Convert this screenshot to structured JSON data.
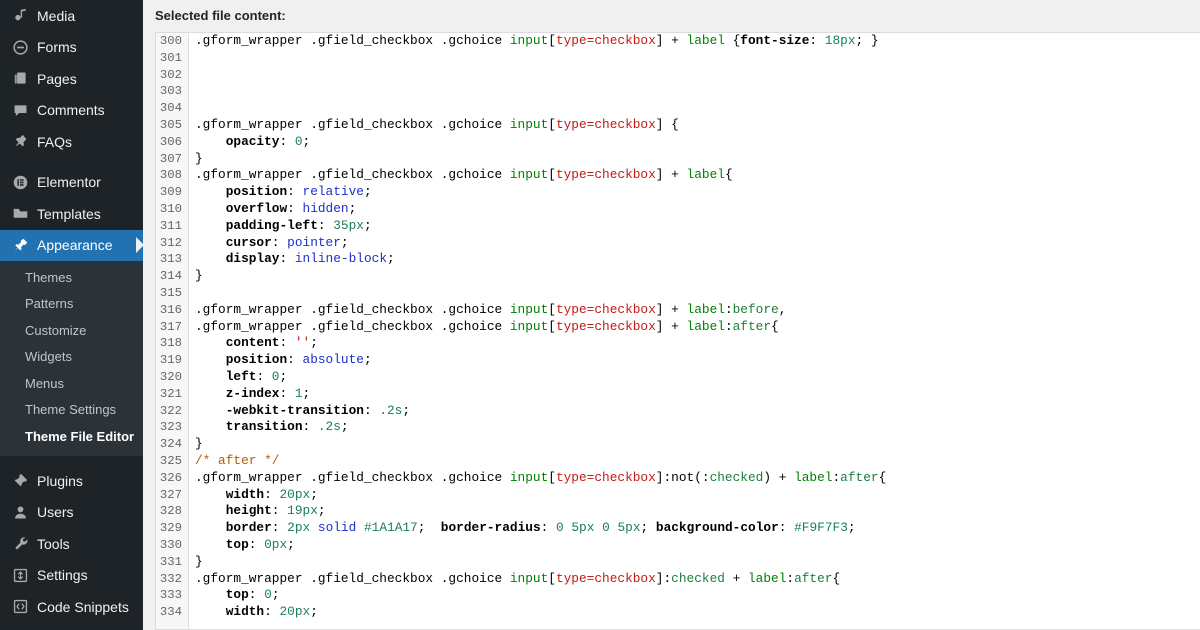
{
  "sidebar": {
    "items": [
      {
        "label": "Media",
        "icon": "media-icon",
        "current": false
      },
      {
        "label": "Forms",
        "icon": "forms-icon",
        "current": false
      },
      {
        "label": "Pages",
        "icon": "pages-icon",
        "current": false
      },
      {
        "label": "Comments",
        "icon": "comments-icon",
        "current": false
      },
      {
        "label": "FAQs",
        "icon": "pin-icon",
        "current": false
      },
      {
        "label": "Elementor",
        "icon": "elementor-icon",
        "current": false
      },
      {
        "label": "Templates",
        "icon": "templates-icon",
        "current": false
      },
      {
        "label": "Appearance",
        "icon": "appearance-icon",
        "current": true
      },
      {
        "label": "Plugins",
        "icon": "plugins-icon",
        "current": false
      },
      {
        "label": "Users",
        "icon": "users-icon",
        "current": false
      },
      {
        "label": "Tools",
        "icon": "tools-icon",
        "current": false
      },
      {
        "label": "Settings",
        "icon": "settings-icon",
        "current": false
      },
      {
        "label": "Code Snippets",
        "icon": "code-icon",
        "current": false
      }
    ],
    "submenu": [
      {
        "label": "Themes",
        "current": false
      },
      {
        "label": "Patterns",
        "current": false
      },
      {
        "label": "Customize",
        "current": false
      },
      {
        "label": "Widgets",
        "current": false
      },
      {
        "label": "Menus",
        "current": false
      },
      {
        "label": "Theme Settings",
        "current": false
      },
      {
        "label": "Theme File Editor",
        "current": true
      }
    ],
    "colors": {
      "background": "#1d2327",
      "submenu_background": "#2c3338",
      "current_highlight": "#2271b1",
      "text": "#f0f0f1",
      "icon": "#a7aaad"
    }
  },
  "main": {
    "content_label": "Selected file content:",
    "editor": {
      "first_line_number": 300,
      "lines": [
        {
          "n": 300,
          "tokens": [
            {
              "t": "sel",
              "v": ".gform_wrapper .gfield_checkbox .gchoice "
            },
            {
              "t": "tag",
              "v": "input"
            },
            {
              "t": "punct",
              "v": "["
            },
            {
              "t": "attr",
              "v": "type=checkbox"
            },
            {
              "t": "punct",
              "v": "]"
            },
            {
              "t": "sel",
              "v": " + "
            },
            {
              "t": "tag",
              "v": "label"
            },
            {
              "t": "sel",
              "v": " {"
            },
            {
              "t": "prop",
              "v": "font-size"
            },
            {
              "t": "punct",
              "v": ": "
            },
            {
              "t": "num",
              "v": "18px"
            },
            {
              "t": "punct",
              "v": "; }"
            }
          ]
        },
        {
          "n": 301,
          "tokens": []
        },
        {
          "n": 302,
          "tokens": []
        },
        {
          "n": 303,
          "tokens": []
        },
        {
          "n": 304,
          "tokens": []
        },
        {
          "n": 305,
          "tokens": [
            {
              "t": "sel",
              "v": ".gform_wrapper .gfield_checkbox .gchoice "
            },
            {
              "t": "tag",
              "v": "input"
            },
            {
              "t": "punct",
              "v": "["
            },
            {
              "t": "attr",
              "v": "type=checkbox"
            },
            {
              "t": "punct",
              "v": "]"
            },
            {
              "t": "sel",
              "v": " {"
            }
          ]
        },
        {
          "n": 306,
          "tokens": [
            {
              "t": "prop",
              "v": "    opacity"
            },
            {
              "t": "punct",
              "v": ": "
            },
            {
              "t": "num",
              "v": "0"
            },
            {
              "t": "punct",
              "v": ";"
            }
          ]
        },
        {
          "n": 307,
          "tokens": [
            {
              "t": "punct",
              "v": "}"
            }
          ]
        },
        {
          "n": 308,
          "tokens": [
            {
              "t": "sel",
              "v": ".gform_wrapper .gfield_checkbox .gchoice "
            },
            {
              "t": "tag",
              "v": "input"
            },
            {
              "t": "punct",
              "v": "["
            },
            {
              "t": "attr",
              "v": "type=checkbox"
            },
            {
              "t": "punct",
              "v": "]"
            },
            {
              "t": "sel",
              "v": " + "
            },
            {
              "t": "tag",
              "v": "label"
            },
            {
              "t": "sel",
              "v": "{"
            }
          ]
        },
        {
          "n": 309,
          "tokens": [
            {
              "t": "prop",
              "v": "    position"
            },
            {
              "t": "punct",
              "v": ": "
            },
            {
              "t": "kw",
              "v": "relative"
            },
            {
              "t": "punct",
              "v": ";"
            }
          ]
        },
        {
          "n": 310,
          "tokens": [
            {
              "t": "prop",
              "v": "    overflow"
            },
            {
              "t": "punct",
              "v": ": "
            },
            {
              "t": "kw",
              "v": "hidden"
            },
            {
              "t": "punct",
              "v": ";"
            }
          ]
        },
        {
          "n": 311,
          "tokens": [
            {
              "t": "prop",
              "v": "    padding-left"
            },
            {
              "t": "punct",
              "v": ": "
            },
            {
              "t": "num",
              "v": "35px"
            },
            {
              "t": "punct",
              "v": ";"
            }
          ]
        },
        {
          "n": 312,
          "tokens": [
            {
              "t": "prop",
              "v": "    cursor"
            },
            {
              "t": "punct",
              "v": ": "
            },
            {
              "t": "kw",
              "v": "pointer"
            },
            {
              "t": "punct",
              "v": ";"
            }
          ]
        },
        {
          "n": 313,
          "tokens": [
            {
              "t": "prop",
              "v": "    display"
            },
            {
              "t": "punct",
              "v": ": "
            },
            {
              "t": "kw",
              "v": "inline-block"
            },
            {
              "t": "punct",
              "v": ";"
            }
          ]
        },
        {
          "n": 314,
          "tokens": [
            {
              "t": "punct",
              "v": "}"
            }
          ]
        },
        {
          "n": 315,
          "tokens": []
        },
        {
          "n": 316,
          "tokens": [
            {
              "t": "sel",
              "v": ".gform_wrapper .gfield_checkbox .gchoice "
            },
            {
              "t": "tag",
              "v": "input"
            },
            {
              "t": "punct",
              "v": "["
            },
            {
              "t": "attr",
              "v": "type=checkbox"
            },
            {
              "t": "punct",
              "v": "]"
            },
            {
              "t": "sel",
              "v": " + "
            },
            {
              "t": "tag",
              "v": "label"
            },
            {
              "t": "punct",
              "v": ":"
            },
            {
              "t": "pseudo",
              "v": "before"
            },
            {
              "t": "punct",
              "v": ","
            }
          ]
        },
        {
          "n": 317,
          "tokens": [
            {
              "t": "sel",
              "v": ".gform_wrapper .gfield_checkbox .gchoice "
            },
            {
              "t": "tag",
              "v": "input"
            },
            {
              "t": "punct",
              "v": "["
            },
            {
              "t": "attr",
              "v": "type=checkbox"
            },
            {
              "t": "punct",
              "v": "]"
            },
            {
              "t": "sel",
              "v": " + "
            },
            {
              "t": "tag",
              "v": "label"
            },
            {
              "t": "punct",
              "v": ":"
            },
            {
              "t": "pseudo",
              "v": "after"
            },
            {
              "t": "punct",
              "v": "{"
            }
          ]
        },
        {
          "n": 318,
          "tokens": [
            {
              "t": "prop",
              "v": "    content"
            },
            {
              "t": "punct",
              "v": ": "
            },
            {
              "t": "str",
              "v": "''"
            },
            {
              "t": "punct",
              "v": ";"
            }
          ]
        },
        {
          "n": 319,
          "tokens": [
            {
              "t": "prop",
              "v": "    position"
            },
            {
              "t": "punct",
              "v": ": "
            },
            {
              "t": "kw",
              "v": "absolute"
            },
            {
              "t": "punct",
              "v": ";"
            }
          ]
        },
        {
          "n": 320,
          "tokens": [
            {
              "t": "prop",
              "v": "    left"
            },
            {
              "t": "punct",
              "v": ": "
            },
            {
              "t": "num",
              "v": "0"
            },
            {
              "t": "punct",
              "v": ";"
            }
          ]
        },
        {
          "n": 321,
          "tokens": [
            {
              "t": "prop",
              "v": "    z-index"
            },
            {
              "t": "punct",
              "v": ": "
            },
            {
              "t": "num",
              "v": "1"
            },
            {
              "t": "punct",
              "v": ";"
            }
          ]
        },
        {
          "n": 322,
          "tokens": [
            {
              "t": "prop",
              "v": "    -webkit-transition"
            },
            {
              "t": "punct",
              "v": ": "
            },
            {
              "t": "num",
              "v": ".2s"
            },
            {
              "t": "punct",
              "v": ";"
            }
          ]
        },
        {
          "n": 323,
          "tokens": [
            {
              "t": "prop",
              "v": "    transition"
            },
            {
              "t": "punct",
              "v": ": "
            },
            {
              "t": "num",
              "v": ".2s"
            },
            {
              "t": "punct",
              "v": ";"
            }
          ]
        },
        {
          "n": 324,
          "tokens": [
            {
              "t": "punct",
              "v": "}"
            }
          ]
        },
        {
          "n": 325,
          "tokens": [
            {
              "t": "comment",
              "v": "/* after */"
            }
          ]
        },
        {
          "n": 326,
          "tokens": [
            {
              "t": "sel",
              "v": ".gform_wrapper .gfield_checkbox .gchoice "
            },
            {
              "t": "tag",
              "v": "input"
            },
            {
              "t": "punct",
              "v": "["
            },
            {
              "t": "attr",
              "v": "type=checkbox"
            },
            {
              "t": "punct",
              "v": "]"
            },
            {
              "t": "punct",
              "v": ":not(:"
            },
            {
              "t": "pseudo",
              "v": "checked"
            },
            {
              "t": "punct",
              "v": ")"
            },
            {
              "t": "sel",
              "v": " + "
            },
            {
              "t": "tag",
              "v": "label"
            },
            {
              "t": "punct",
              "v": ":"
            },
            {
              "t": "pseudo",
              "v": "after"
            },
            {
              "t": "punct",
              "v": "{"
            }
          ]
        },
        {
          "n": 327,
          "tokens": [
            {
              "t": "prop",
              "v": "    width"
            },
            {
              "t": "punct",
              "v": ": "
            },
            {
              "t": "num",
              "v": "20px"
            },
            {
              "t": "punct",
              "v": ";"
            }
          ]
        },
        {
          "n": 328,
          "tokens": [
            {
              "t": "prop",
              "v": "    height"
            },
            {
              "t": "punct",
              "v": ": "
            },
            {
              "t": "num",
              "v": "19px"
            },
            {
              "t": "punct",
              "v": ";"
            }
          ]
        },
        {
          "n": 329,
          "tokens": [
            {
              "t": "prop",
              "v": "    border"
            },
            {
              "t": "punct",
              "v": ": "
            },
            {
              "t": "num",
              "v": "2px"
            },
            {
              "t": "punct",
              "v": " "
            },
            {
              "t": "kw",
              "v": "solid"
            },
            {
              "t": "punct",
              "v": " "
            },
            {
              "t": "num",
              "v": "#1A1A17"
            },
            {
              "t": "punct",
              "v": ";  "
            },
            {
              "t": "prop",
              "v": "border-radius"
            },
            {
              "t": "punct",
              "v": ": "
            },
            {
              "t": "num",
              "v": "0"
            },
            {
              "t": "punct",
              "v": " "
            },
            {
              "t": "num",
              "v": "5px"
            },
            {
              "t": "punct",
              "v": " "
            },
            {
              "t": "num",
              "v": "0"
            },
            {
              "t": "punct",
              "v": " "
            },
            {
              "t": "num",
              "v": "5px"
            },
            {
              "t": "punct",
              "v": "; "
            },
            {
              "t": "prop",
              "v": "background-color"
            },
            {
              "t": "punct",
              "v": ": "
            },
            {
              "t": "num",
              "v": "#F9F7F3"
            },
            {
              "t": "punct",
              "v": ";"
            }
          ]
        },
        {
          "n": 330,
          "tokens": [
            {
              "t": "prop",
              "v": "    top"
            },
            {
              "t": "punct",
              "v": ": "
            },
            {
              "t": "num",
              "v": "0px"
            },
            {
              "t": "punct",
              "v": ";"
            }
          ]
        },
        {
          "n": 331,
          "tokens": [
            {
              "t": "punct",
              "v": "}"
            }
          ]
        },
        {
          "n": 332,
          "tokens": [
            {
              "t": "sel",
              "v": ".gform_wrapper .gfield_checkbox .gchoice "
            },
            {
              "t": "tag",
              "v": "input"
            },
            {
              "t": "punct",
              "v": "["
            },
            {
              "t": "attr",
              "v": "type=checkbox"
            },
            {
              "t": "punct",
              "v": "]"
            },
            {
              "t": "punct",
              "v": ":"
            },
            {
              "t": "pseudo",
              "v": "checked"
            },
            {
              "t": "sel",
              "v": " + "
            },
            {
              "t": "tag",
              "v": "label"
            },
            {
              "t": "punct",
              "v": ":"
            },
            {
              "t": "pseudo",
              "v": "after"
            },
            {
              "t": "punct",
              "v": "{"
            }
          ]
        },
        {
          "n": 333,
          "tokens": [
            {
              "t": "prop",
              "v": "    top"
            },
            {
              "t": "punct",
              "v": ": "
            },
            {
              "t": "num",
              "v": "0"
            },
            {
              "t": "punct",
              "v": ";"
            }
          ]
        },
        {
          "n": 334,
          "tokens": [
            {
              "t": "prop",
              "v": "    width"
            },
            {
              "t": "punct",
              "v": ": "
            },
            {
              "t": "num",
              "v": "20px"
            },
            {
              "t": "punct",
              "v": ";"
            }
          ]
        }
      ],
      "syntax_colors": {
        "selector": "#000000",
        "tag": "#008000",
        "attribute": "#c41a16",
        "pseudo": "#1a7f37",
        "property": "#000000",
        "keyword": "#1d30cc",
        "number": "#1a7f5a",
        "string": "#c41a16",
        "comment": "#b35c00",
        "gutter_text": "#666666",
        "gutter_background": "#f7f7f7"
      }
    }
  }
}
